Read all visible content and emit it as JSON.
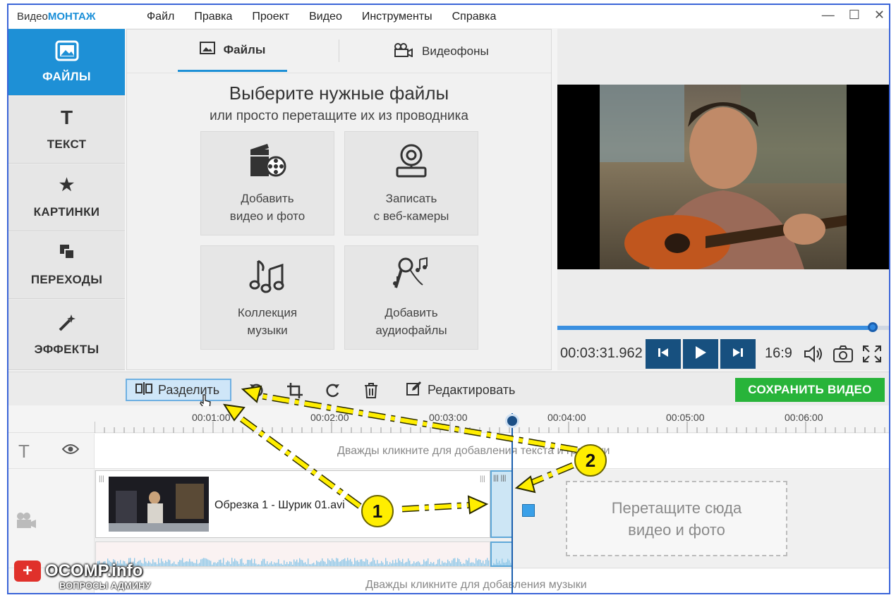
{
  "app": {
    "logo_prefix": "Видео",
    "logo_brand": "МОНТАЖ"
  },
  "menu": [
    "Файл",
    "Правка",
    "Проект",
    "Видео",
    "Инструменты",
    "Справка"
  ],
  "sidebar": [
    {
      "label": "ФАЙЛЫ",
      "icon": "image-icon",
      "active": true
    },
    {
      "label": "ТЕКСТ",
      "icon": "text-icon"
    },
    {
      "label": "КАРТИНКИ",
      "icon": "star-icon"
    },
    {
      "label": "ПЕРЕХОДЫ",
      "icon": "transitions-icon"
    },
    {
      "label": "ЭФФЕКТЫ",
      "icon": "magic-wand-icon"
    }
  ],
  "tabs": [
    {
      "label": "Файлы",
      "icon": "image-icon",
      "active": true
    },
    {
      "label": "Видеофоны",
      "icon": "film-camera-icon"
    }
  ],
  "files": {
    "heading": "Выберите нужные файлы",
    "subheading": "или просто перетащите их из проводника",
    "tiles": [
      {
        "line1": "Добавить",
        "line2": "видео и фото",
        "icon": "film-reel-icon"
      },
      {
        "line1": "Записать",
        "line2": "с веб-камеры",
        "icon": "webcam-icon"
      },
      {
        "line1": "Коллекция",
        "line2": "музыки",
        "icon": "music-notes-icon"
      },
      {
        "line1": "Добавить",
        "line2": "аудиофайлы",
        "icon": "microphone-icon"
      }
    ]
  },
  "player": {
    "timecode": "00:03:31.962",
    "aspect": "16:9",
    "progress_fraction": 0.95
  },
  "toolbar": {
    "split": "Разделить",
    "edit": "Редактировать",
    "save": "СОХРАНИТЬ ВИДЕО"
  },
  "ruler": [
    "00:01:00",
    "00:02:00",
    "00:03:00",
    "00:04:00",
    "00:05:00",
    "00:06:00"
  ],
  "timeline": {
    "text_hint": "Дважды кликните для добавления текста и графики",
    "clip_name": "Обрезка 1 - Шурик 01.avi",
    "drop_line1": "Перетащите сюда",
    "drop_line2": "видео и фото",
    "music_hint": "Дважды кликните для добавления музыки"
  },
  "annotations": {
    "badge1": "1",
    "badge2": "2"
  },
  "watermark": {
    "title": "OCOMP.info",
    "subtitle": "ВОПРОСЫ АДМИНУ"
  },
  "colors": {
    "accent": "#1e90d6",
    "save": "#28b43a",
    "highlight": "#ffee00"
  }
}
